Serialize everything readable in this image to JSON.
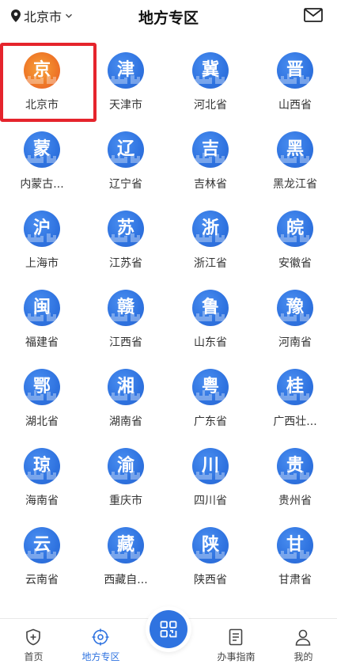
{
  "header": {
    "location": "北京市",
    "title": "地方专区"
  },
  "regions": [
    {
      "glyph": "京",
      "name": "北京市",
      "highlighted": true
    },
    {
      "glyph": "津",
      "name": "天津市"
    },
    {
      "glyph": "冀",
      "name": "河北省"
    },
    {
      "glyph": "晋",
      "name": "山西省"
    },
    {
      "glyph": "蒙",
      "name": "内蒙古..."
    },
    {
      "glyph": "辽",
      "name": "辽宁省"
    },
    {
      "glyph": "吉",
      "name": "吉林省"
    },
    {
      "glyph": "黑",
      "name": "黑龙江省"
    },
    {
      "glyph": "沪",
      "name": "上海市"
    },
    {
      "glyph": "苏",
      "name": "江苏省"
    },
    {
      "glyph": "浙",
      "name": "浙江省"
    },
    {
      "glyph": "皖",
      "name": "安徽省"
    },
    {
      "glyph": "闽",
      "name": "福建省"
    },
    {
      "glyph": "赣",
      "name": "江西省"
    },
    {
      "glyph": "鲁",
      "name": "山东省"
    },
    {
      "glyph": "豫",
      "name": "河南省"
    },
    {
      "glyph": "鄂",
      "name": "湖北省"
    },
    {
      "glyph": "湘",
      "name": "湖南省"
    },
    {
      "glyph": "粤",
      "name": "广东省"
    },
    {
      "glyph": "桂",
      "name": "广西壮..."
    },
    {
      "glyph": "琼",
      "name": "海南省"
    },
    {
      "glyph": "渝",
      "name": "重庆市"
    },
    {
      "glyph": "川",
      "name": "四川省"
    },
    {
      "glyph": "贵",
      "name": "贵州省"
    },
    {
      "glyph": "云",
      "name": "云南省"
    },
    {
      "glyph": "藏",
      "name": "西藏自..."
    },
    {
      "glyph": "陕",
      "name": "陕西省"
    },
    {
      "glyph": "甘",
      "name": "甘肃省"
    }
  ],
  "tabbar": {
    "home": "首页",
    "local": "地方专区",
    "guide": "办事指南",
    "mine": "我的",
    "active": "local"
  },
  "colors": {
    "accent": "#2f73e0",
    "highlight_border": "#e5242c",
    "beijing_badge": "#ef7a28"
  }
}
